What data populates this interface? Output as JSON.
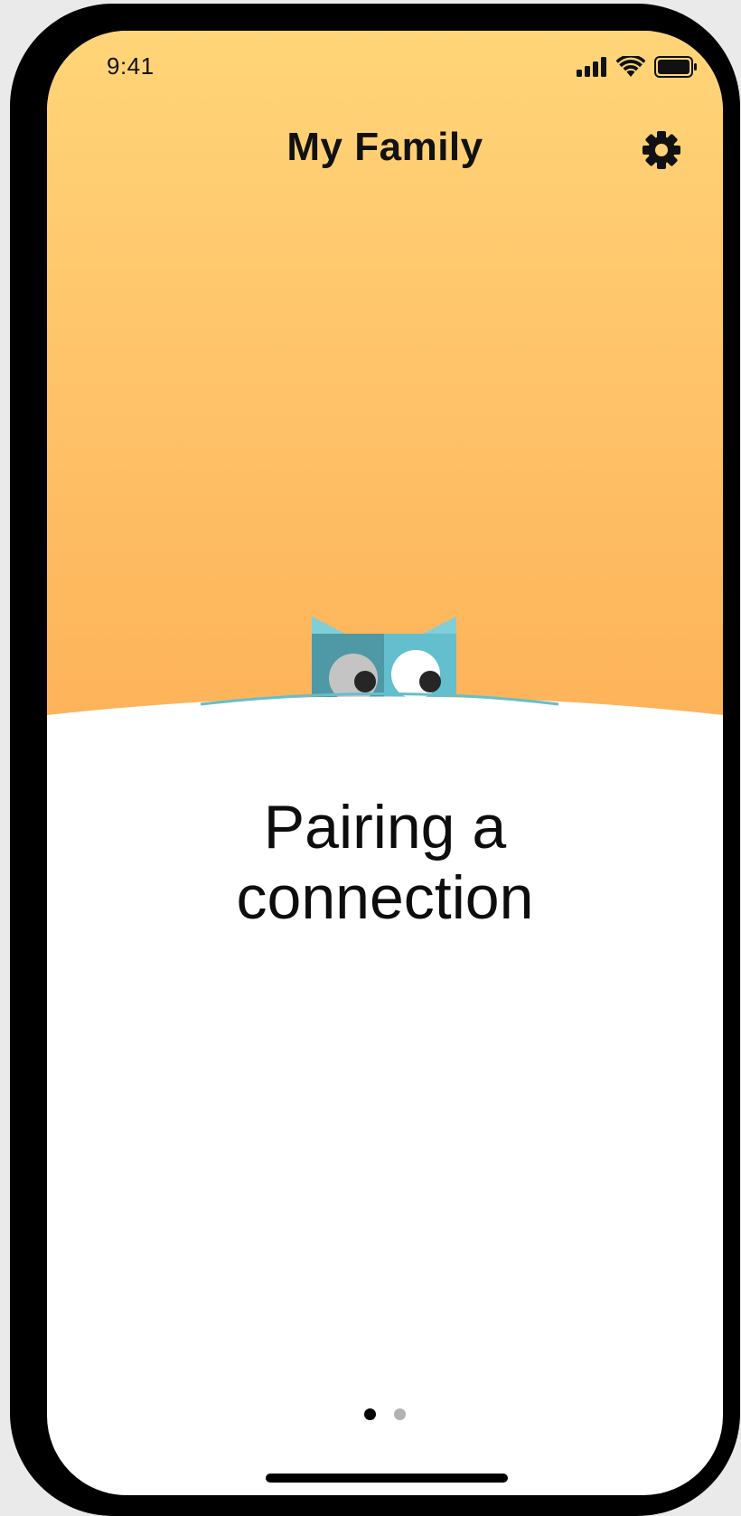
{
  "status_bar": {
    "time": "9:41",
    "icons": [
      "cellular-signal-icon",
      "wifi-icon",
      "battery-icon"
    ]
  },
  "header": {
    "title": "My Family",
    "settings_icon": "gear-icon"
  },
  "hero": {
    "mascot": "peeking-box-mascot",
    "gradient_top": "#ffd578",
    "gradient_bottom": "#fdb157"
  },
  "content": {
    "headline_line1": "Pairing a",
    "headline_line2": "connection"
  },
  "pagination": {
    "total": 2,
    "current": 1,
    "active_color": "#000000",
    "inactive_color": "#b3b3b3"
  }
}
